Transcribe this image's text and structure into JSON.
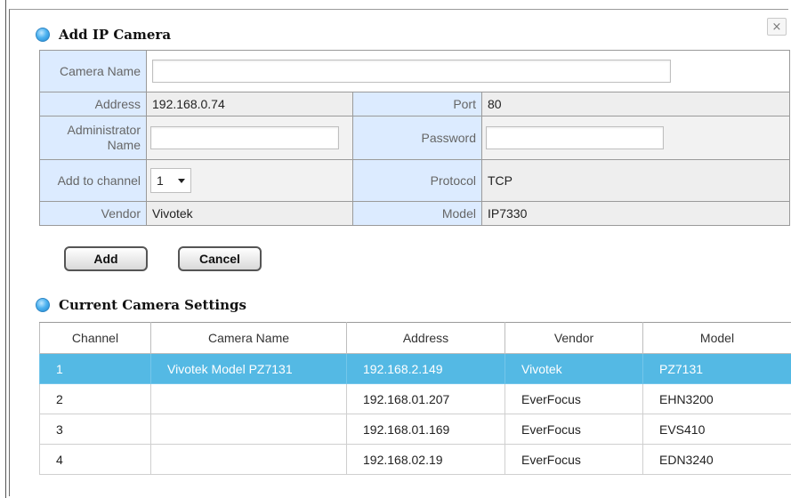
{
  "dialog": {
    "close_glyph": "×"
  },
  "add_section": {
    "title": "Add IP Camera",
    "fields": {
      "camera_name_label": "Camera Name",
      "camera_name_value": "",
      "address_label": "Address",
      "address_value": "192.168.0.74",
      "port_label": "Port",
      "port_value": "80",
      "admin_label": "Administrator Name",
      "admin_value": "",
      "password_label": "Password",
      "password_value": "",
      "channel_label": "Add to channel",
      "channel_value": "1",
      "protocol_label": "Protocol",
      "protocol_value": "TCP",
      "vendor_label": "Vendor",
      "vendor_value": "Vivotek",
      "model_label": "Model",
      "model_value": "IP7330"
    },
    "buttons": {
      "add": "Add",
      "cancel": "Cancel"
    }
  },
  "current_section": {
    "title": "Current Camera Settings",
    "columns": [
      "Channel",
      "Camera Name",
      "Address",
      "Vendor",
      "Model"
    ],
    "rows": [
      {
        "channel": "1",
        "name": "Vivotek Model PZ7131",
        "address": "192.168.2.149",
        "vendor": "Vivotek",
        "model": "PZ7131",
        "selected": true
      },
      {
        "channel": "2",
        "name": "",
        "address": "192.168.01.207",
        "vendor": "EverFocus",
        "model": "EHN3200"
      },
      {
        "channel": "3",
        "name": "",
        "address": "192.168.01.169",
        "vendor": "EverFocus",
        "model": "EVS410"
      },
      {
        "channel": "4",
        "name": "",
        "address": "192.168.02.19",
        "vendor": "EverFocus",
        "model": "EDN3240"
      }
    ]
  },
  "icons": {
    "section_bullet": "blue-circle-icon",
    "close": "close-icon",
    "dropdown": "chevron-down-icon"
  },
  "colors": {
    "selected_row": "#54b9e4",
    "label_cell": "#dcebff",
    "value_cell": "#eeeeee"
  }
}
